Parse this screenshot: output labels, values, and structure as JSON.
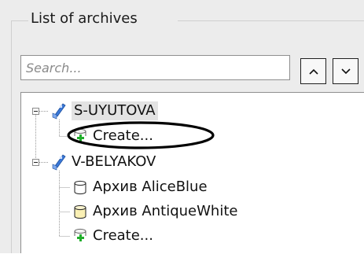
{
  "group": {
    "title": "List of archives"
  },
  "search": {
    "placeholder": "Search..."
  },
  "nav": {
    "up_glyph": "up-chevron",
    "down_glyph": "down-chevron"
  },
  "tree": {
    "servers": [
      {
        "name": "S-UYUTOVA",
        "expanded": true,
        "selected": true,
        "children": [
          {
            "type": "create",
            "label": "Create...",
            "icon": "add-archive-icon"
          }
        ]
      },
      {
        "name": "V-BELYAKOV",
        "expanded": true,
        "selected": false,
        "children": [
          {
            "type": "archive",
            "label": "Архив AliceBlue",
            "icon": "archive-cylinder-icon",
            "color": "#ffffff"
          },
          {
            "type": "archive",
            "label": "Архив AntiqueWhite",
            "icon": "archive-cylinder-icon",
            "color": "#faf0b4"
          },
          {
            "type": "create",
            "label": "Create...",
            "icon": "add-archive-icon"
          }
        ]
      }
    ]
  },
  "colors": {
    "panel_bg": "#ececec",
    "tree_bg": "#ffffff",
    "add_plus": "#1fae2a",
    "server_icon": "#3a78d8",
    "highlight_ellipse": "#000000"
  }
}
